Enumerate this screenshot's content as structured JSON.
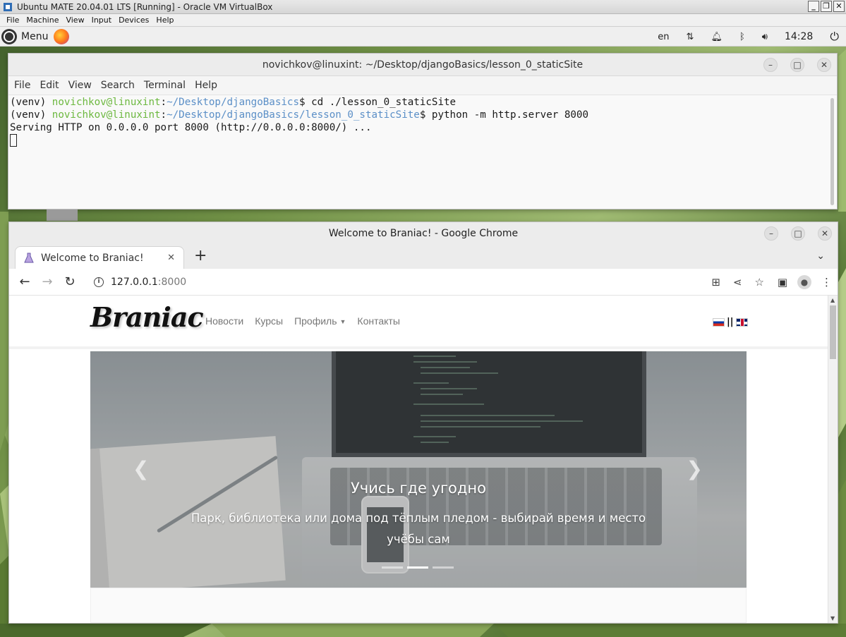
{
  "vbox": {
    "title": "Ubuntu MATE 20.04.01 LTS [Running] - Oracle VM VirtualBox",
    "menu": [
      "File",
      "Machine",
      "View",
      "Input",
      "Devices",
      "Help"
    ]
  },
  "panel": {
    "menu_label": "Menu",
    "keyboard_layout": "en",
    "clock": "14:28"
  },
  "terminal": {
    "title": "novichkov@linuxint: ~/Desktop/djangoBasics/lesson_0_staticSite",
    "menu": [
      "File",
      "Edit",
      "View",
      "Search",
      "Terminal",
      "Help"
    ],
    "lines": [
      {
        "venv": "(venv) ",
        "user": "novichkov@linuxint",
        "colon": ":",
        "path": "~/Desktop/djangoBasics",
        "cmd": "$ cd ./lesson_0_staticSite"
      },
      {
        "venv": "(venv) ",
        "user": "novichkov@linuxint",
        "colon": ":",
        "path": "~/Desktop/djangoBasics/lesson_0_staticSite",
        "cmd": "$ python -m http.server 8000"
      }
    ],
    "output": "Serving HTTP on 0.0.0.0 port 8000 (http://0.0.0.0:8000/) ..."
  },
  "chrome": {
    "title": "Welcome to Braniac! - Google Chrome",
    "tab_title": "Welcome to Braniac!",
    "url_host": "127.0.0.1",
    "url_port": ":8000"
  },
  "site": {
    "brand": "Braniac",
    "nav": [
      "Новости",
      "Курсы",
      "Профиль",
      "Контакты"
    ],
    "carousel": {
      "title": "Учись где угодно",
      "text": "Парк, библиотека или дома под тёплым пледом - выбирай время и место учёбы сам",
      "slides": 3,
      "active_slide": 2
    }
  }
}
